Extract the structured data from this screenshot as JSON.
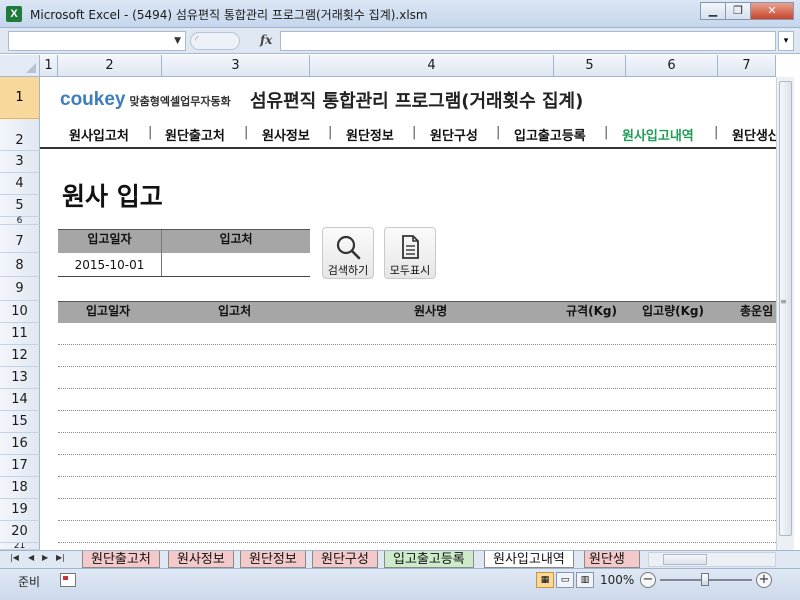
{
  "window": {
    "title": "Microsoft Excel - (5494) 섬유편직 통합관리 프로그램(거래횟수 집계).xlsm",
    "app_icon": "excel-icon",
    "minimize": "▁",
    "restore": "❐",
    "close": "✕"
  },
  "formula_bar": {
    "name_box": "",
    "fx_label": "fx",
    "formula": ""
  },
  "columns": [
    "1",
    "2",
    "3",
    "4",
    "5",
    "6",
    "7"
  ],
  "rows": [
    "1",
    "2",
    "3",
    "4",
    "5",
    "6",
    "7",
    "8",
    "9",
    "10",
    "11",
    "12",
    "13",
    "14",
    "15",
    "16",
    "17",
    "18",
    "19",
    "20",
    "21"
  ],
  "header": {
    "logo_text": "coukey",
    "logo_sub": "맞춤형엑셀업무자동화",
    "app_title": "섬유편직 통합관리 프로그램(거래횟수 집계)"
  },
  "nav": {
    "items": [
      "원사입고처",
      "원단출고처",
      "원사정보",
      "원단정보",
      "원단구성",
      "입고출고등록",
      "원사입고내역",
      "원단생산"
    ],
    "active_index": 6
  },
  "page_heading": "원사 입고",
  "filter": {
    "col1": "입고일자",
    "col2": "입고처",
    "date_value": "2015-10-01",
    "place_value": ""
  },
  "buttons": {
    "search": "검색하기",
    "show_all": "모두표시"
  },
  "table": {
    "headers": [
      "입고일자",
      "입고처",
      "원사명",
      "규격(Kg)",
      "입고량(Kg)",
      "총운임"
    ]
  },
  "sheet_tabs": [
    "원단출고처",
    "원사정보",
    "원단정보",
    "원단구성",
    "입고출고등록",
    "원사입고내역",
    "원단생"
  ],
  "active_sheet_index": 5,
  "status": {
    "ready": "준비",
    "zoom": "100%"
  },
  "colors": {
    "active_nav": "#1f9d55",
    "header_fill": "#a6a6a6",
    "logo_blue": "#3d7ebf",
    "tab_pink": "#f4c9c9",
    "tab_green": "#cdebc9"
  }
}
